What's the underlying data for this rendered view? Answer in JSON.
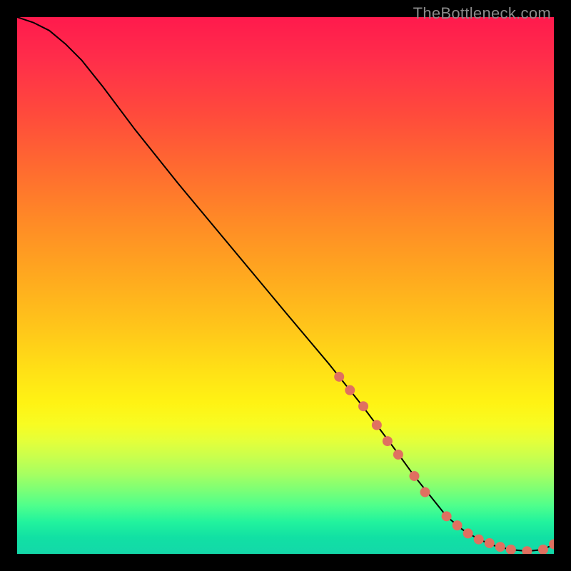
{
  "watermark": "TheBottleneck.com",
  "chart_data": {
    "type": "line",
    "title": "",
    "xlabel": "",
    "ylabel": "",
    "xlim": [
      0,
      100
    ],
    "ylim": [
      0,
      100
    ],
    "grid": false,
    "legend": false,
    "series": [
      {
        "name": "bottleneck-curve",
        "x": [
          0,
          3,
          6,
          9,
          12,
          16,
          22,
          30,
          40,
          50,
          58,
          64,
          70,
          74,
          78,
          80,
          83,
          86,
          89,
          92,
          95,
          98,
          100
        ],
        "y": [
          100,
          99,
          97.5,
          95,
          92,
          87,
          79,
          69,
          57,
          45,
          35.5,
          28,
          20,
          14.5,
          9.5,
          7,
          4.5,
          2.7,
          1.5,
          0.8,
          0.5,
          0.8,
          1.8
        ],
        "stroke": "#000000",
        "stroke_width": 2
      },
      {
        "name": "highlight-markers",
        "type": "scatter",
        "x": [
          60,
          62,
          64.5,
          67,
          69,
          71,
          74,
          76,
          80,
          82,
          84,
          86,
          88,
          90,
          92,
          95,
          98,
          100
        ],
        "y": [
          33,
          30.5,
          27.5,
          24,
          21,
          18.5,
          14.5,
          11.5,
          7,
          5.3,
          3.8,
          2.7,
          2.0,
          1.3,
          0.8,
          0.5,
          0.8,
          1.8
        ],
        "marker_color": "#e07060",
        "marker_radius_px": 7
      }
    ]
  }
}
